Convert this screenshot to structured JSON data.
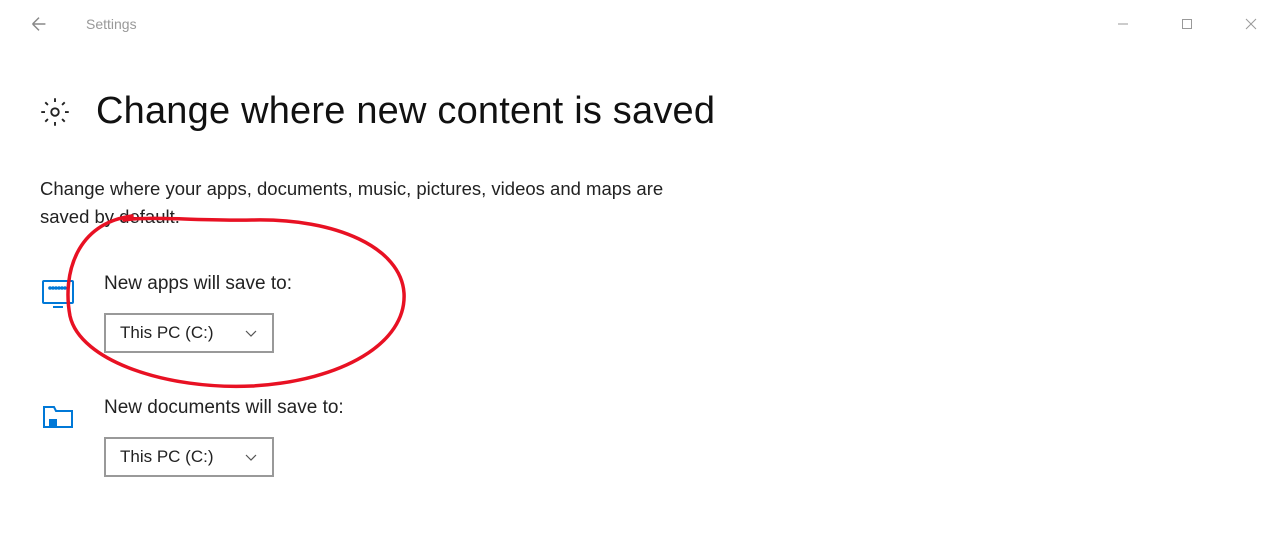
{
  "window": {
    "app_title": "Settings"
  },
  "page": {
    "heading": "Change where new content is saved",
    "description": "Change where your apps, documents, music, pictures, videos and maps are saved by default."
  },
  "settings": {
    "apps": {
      "label": "New apps will save to:",
      "value": "This PC (C:)"
    },
    "documents": {
      "label": "New documents will save to:",
      "value": "This PC (C:)"
    }
  }
}
